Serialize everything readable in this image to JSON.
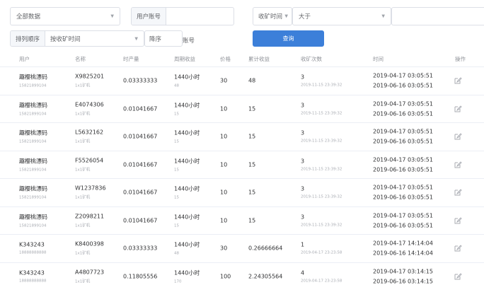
{
  "filters": {
    "platform_select": "全部数据",
    "user_account_label": "用户账号",
    "user_account_value": "",
    "time_field_select": "收矿时间",
    "operator_select": "大于",
    "condition_value": "",
    "sort_label": "排列顺序",
    "sort_field_select": "按收矿时间",
    "sort_dir_label": "降序",
    "account_label": "账号",
    "query_button": "查询"
  },
  "columns": [
    "用户",
    "名称",
    "时产量",
    "周期收益",
    "价格",
    "累计收益",
    "收矿次数",
    "时间",
    "操作"
  ],
  "rows": [
    {
      "user": "趣樱桃漂码",
      "phone": "15821899104",
      "name": "X9825201",
      "type": "1x1矿机",
      "hourly": "0.03333333",
      "cycle": "1440小时",
      "cycle_sub": "48",
      "price": "30",
      "total": "48",
      "count": "3",
      "count_time": "2019-11-15 23:39:32",
      "time1": "2019-04-17 03:05:51",
      "time2": "2019-06-16 03:05:51"
    },
    {
      "user": "趣樱桃漂码",
      "phone": "15821899104",
      "name": "E4074306",
      "type": "1x1矿机",
      "hourly": "0.01041667",
      "cycle": "1440小时",
      "cycle_sub": "15",
      "price": "10",
      "total": "15",
      "count": "3",
      "count_time": "2019-11-15 23:39:32",
      "time1": "2019-04-17 03:05:51",
      "time2": "2019-06-16 03:05:51"
    },
    {
      "user": "趣樱桃漂码",
      "phone": "15821899104",
      "name": "L5632162",
      "type": "1x1矿机",
      "hourly": "0.01041667",
      "cycle": "1440小时",
      "cycle_sub": "15",
      "price": "10",
      "total": "15",
      "count": "3",
      "count_time": "2019-11-15 23:39:32",
      "time1": "2019-04-17 03:05:51",
      "time2": "2019-06-16 03:05:51"
    },
    {
      "user": "趣樱桃漂码",
      "phone": "15821899104",
      "name": "F5526054",
      "type": "1x1矿机",
      "hourly": "0.01041667",
      "cycle": "1440小时",
      "cycle_sub": "15",
      "price": "10",
      "total": "15",
      "count": "3",
      "count_time": "2019-11-15 23:39:32",
      "time1": "2019-04-17 03:05:51",
      "time2": "2019-06-16 03:05:51"
    },
    {
      "user": "趣樱桃漂码",
      "phone": "15821899104",
      "name": "W1237836",
      "type": "1x1矿机",
      "hourly": "0.01041667",
      "cycle": "1440小时",
      "cycle_sub": "15",
      "price": "10",
      "total": "15",
      "count": "3",
      "count_time": "2019-11-15 23:39:32",
      "time1": "2019-04-17 03:05:51",
      "time2": "2019-06-16 03:05:51"
    },
    {
      "user": "趣樱桃漂码",
      "phone": "15821899104",
      "name": "Z2098211",
      "type": "1x1矿机",
      "hourly": "0.01041667",
      "cycle": "1440小时",
      "cycle_sub": "15",
      "price": "10",
      "total": "15",
      "count": "3",
      "count_time": "2019-11-15 23:39:32",
      "time1": "2019-04-17 03:05:51",
      "time2": "2019-06-16 03:05:51"
    },
    {
      "user": "K343243",
      "phone": "18888888888",
      "name": "K8400398",
      "type": "1x1矿机",
      "hourly": "0.03333333",
      "cycle": "1440小时",
      "cycle_sub": "48",
      "price": "30",
      "total": "0.26666664",
      "count": "1",
      "count_time": "2019-04-17 23:23:58",
      "time1": "2019-04-17 14:14:04",
      "time2": "2019-06-16 14:14:04"
    },
    {
      "user": "K343243",
      "phone": "18888888888",
      "name": "A4807723",
      "type": "1x1矿机",
      "hourly": "0.11805556",
      "cycle": "1440小时",
      "cycle_sub": "170",
      "price": "100",
      "total": "2.24305564",
      "count": "4",
      "count_time": "2019-04-17 23:23:58",
      "time1": "2019-04-17 03:14:15",
      "time2": "2019-06-16 03:14:15"
    }
  ],
  "colors": {
    "primary": "#3c7fd9",
    "border": "#dcdfe6",
    "muted": "#a8abb2"
  },
  "icons": {
    "edit": "edit-icon",
    "dropdown": "chevron-down-icon"
  }
}
